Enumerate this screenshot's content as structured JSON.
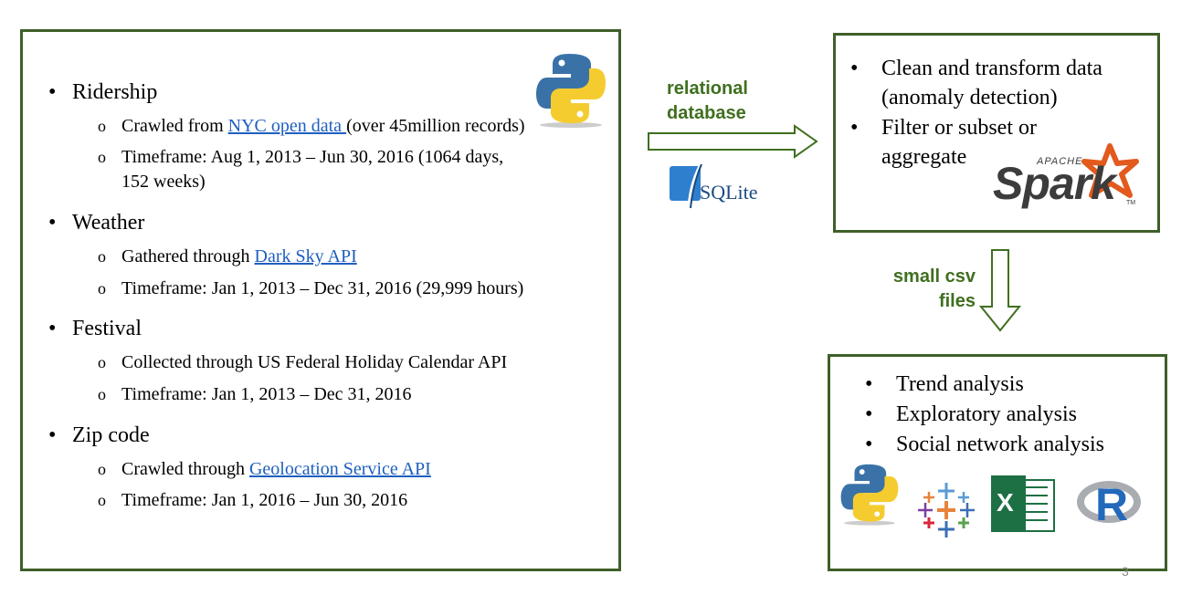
{
  "left_panel": {
    "sections": [
      {
        "title": "Ridership",
        "items": [
          {
            "prefix": "Crawled from ",
            "link": "NYC open data ",
            "suffix": "(over 45million records)"
          },
          {
            "text": "Timeframe: Aug 1, 2013 – Jun 30, 2016 (1064 days,",
            "text2": "152 weeks)"
          }
        ]
      },
      {
        "title": "Weather",
        "items": [
          {
            "prefix": "Gathered through ",
            "link": "Dark Sky API"
          },
          {
            "text": "Timeframe: Jan 1, 2013 – Dec 31, 2016 (29,999 hours)"
          }
        ]
      },
      {
        "title": "Festival",
        "items": [
          {
            "text": "Collected through US Federal Holiday Calendar API"
          },
          {
            "text": "Timeframe: Jan 1, 2013 – Dec 31, 2016"
          }
        ]
      },
      {
        "title": "Zip code",
        "items": [
          {
            "prefix": "Crawled through ",
            "link": "Geolocation Service API"
          },
          {
            "text": "Timeframe: Jan 1, 2016 – Jun 30, 2016"
          }
        ]
      }
    ]
  },
  "arrow1_label": {
    "line1": "relational",
    "line2": "database"
  },
  "sqlite_logo_text": "SQLite",
  "spark_panel": {
    "items": [
      {
        "line1": "Clean and transform data",
        "line2": "(anomaly detection)"
      },
      {
        "line1": "Filter or subset or",
        "line2": "aggregate"
      }
    ],
    "logo_small": "APACHE",
    "logo_big": "Spark",
    "logo_tm": "TM"
  },
  "arrow2_label": {
    "line1": "small csv",
    "line2": "files"
  },
  "analysis_panel": {
    "items": [
      "Trend analysis",
      "Exploratory analysis",
      "Social network analysis"
    ],
    "excel_letter": "X",
    "r_letter": "R"
  },
  "bullet_char": "•",
  "sub_bullet_char": "o",
  "page_number": "3",
  "colors": {
    "border": "#3f5f28",
    "label_green": "#3f6f1f",
    "link_blue": "#1f5fbf",
    "spark_orange": "#e25a1c"
  }
}
